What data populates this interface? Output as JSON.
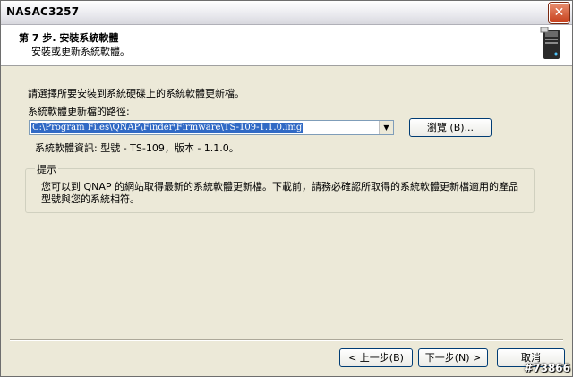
{
  "window": {
    "title": "NASAC3257",
    "close_glyph": "✕"
  },
  "header": {
    "step_title": "第 7 步. 安裝系統軟體",
    "step_subtitle": "安裝或更新系統軟體。",
    "icon": "server-icon"
  },
  "body": {
    "instruction": "請選擇所要安裝到系統硬碟上的系統軟體更新檔。",
    "path_label": "系統軟體更新檔的路徑:",
    "path_value": "C:\\Program Files\\QNAP\\Finder\\Firmware\\TS-109-1.1.0.img",
    "browse_label": "瀏覽 (B)...",
    "firmware_info": "系統軟體資訊: 型號 - TS-109，版本 - 1.1.0。"
  },
  "hint": {
    "legend": "提示",
    "text": "您可以到 QNAP 的網站取得最新的系統軟體更新檔。下載前，請務必確認所取得的系統軟體更新檔適用的產品型號與您的系統相符。"
  },
  "footer": {
    "back_label": "< 上一步(B)",
    "next_label": "下一步(N) >",
    "cancel_label": "取消"
  },
  "watermark": "#73866"
}
